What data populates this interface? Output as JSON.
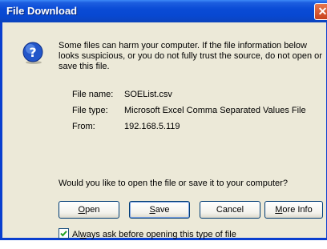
{
  "dialog": {
    "title": "File Download",
    "close_glyph": "✕",
    "warning_text": "Some files can harm your computer. If the file information below looks suspicious, or you do not fully trust the source, do not open or save this file.",
    "file": {
      "name_label": "File name:",
      "name_value": "SOEList.csv",
      "type_label": "File type:",
      "type_value": "Microsoft Excel Comma Separated Values File",
      "from_label": "From:",
      "from_value": "192.168.5.119"
    },
    "question": "Would you like to open the file or save it to your computer?",
    "buttons": {
      "open": {
        "accel": "O",
        "rest": "pen"
      },
      "save": {
        "accel": "S",
        "rest": "ave"
      },
      "cancel": {
        "label": "Cancel"
      },
      "more_info": {
        "accel": "M",
        "rest": "ore Info"
      }
    },
    "checkbox": {
      "checked": true,
      "pre": "Al",
      "accel": "w",
      "rest": "ays ask before opening this type of file"
    },
    "icon": "question-icon"
  }
}
